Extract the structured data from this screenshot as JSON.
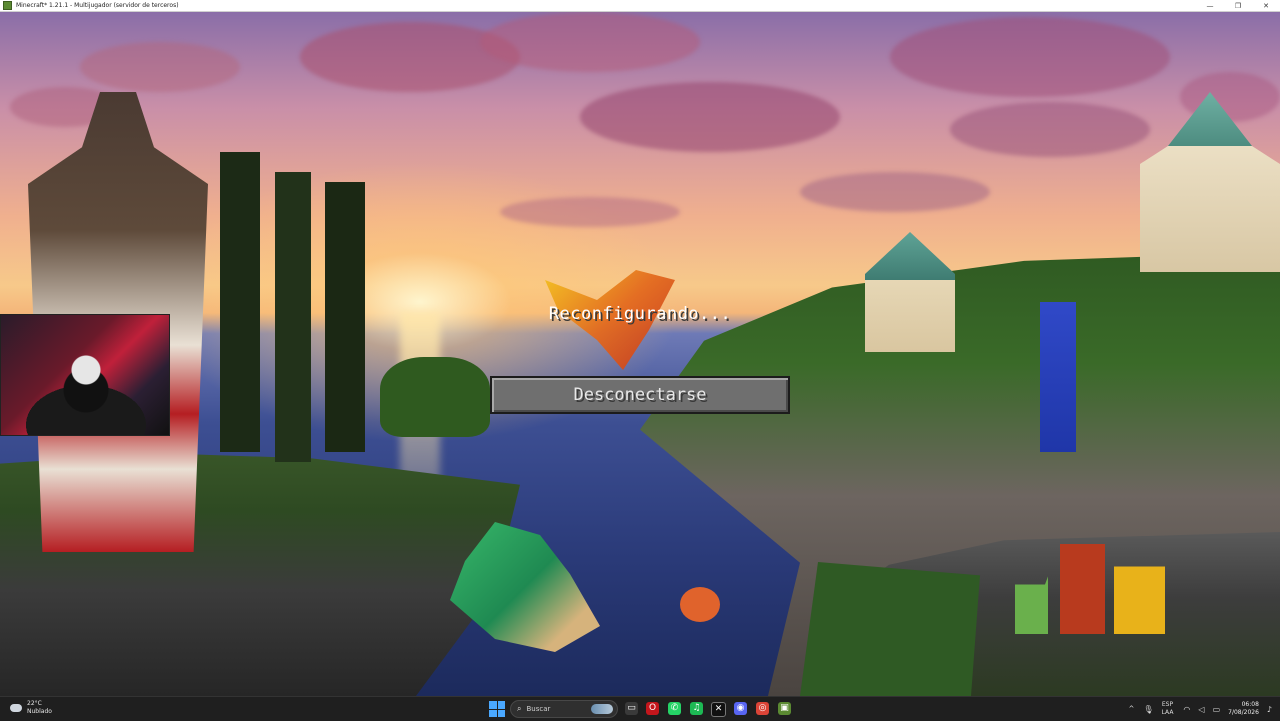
{
  "window": {
    "title": "Minecraft* 1.21.1 - Multijugador (servidor de terceros)",
    "controls": {
      "minimize": "—",
      "maximize": "❐",
      "close": "✕"
    }
  },
  "game": {
    "status_text": "Reconfigurando...",
    "disconnect_button_label": "Desconectarse"
  },
  "taskbar": {
    "weather": {
      "temperature": "22°C",
      "condition": "Nublado"
    },
    "search": {
      "placeholder": "Buscar"
    },
    "apps": [
      {
        "name": "task-view",
        "glyph": "▭",
        "color": "#3a3a3a"
      },
      {
        "name": "opera",
        "glyph": "O",
        "color": "#c4161c"
      },
      {
        "name": "whatsapp",
        "glyph": "✆",
        "color": "#25d366"
      },
      {
        "name": "spotify",
        "glyph": "♫",
        "color": "#1db954"
      },
      {
        "name": "app-red",
        "glyph": "✦",
        "color": "#b0122e"
      },
      {
        "name": "capcut",
        "glyph": "✕",
        "color": "#111111"
      },
      {
        "name": "discord",
        "glyph": "◉",
        "color": "#5865f2"
      },
      {
        "name": "chrome",
        "glyph": "◎",
        "color": "#db4437"
      },
      {
        "name": "minecraft",
        "glyph": "▣",
        "color": "#5b8a32"
      }
    ],
    "tray": {
      "chevron": "^",
      "lang_top": "ESP",
      "lang_bottom": "LAA",
      "time": "06:08",
      "date": "7/08/2026"
    }
  },
  "colors": {
    "button_face": "#6f6f6f",
    "button_border": "#1c1c1c",
    "status_text": "#ffffff",
    "taskbar_bg": "#1f1f1f"
  }
}
